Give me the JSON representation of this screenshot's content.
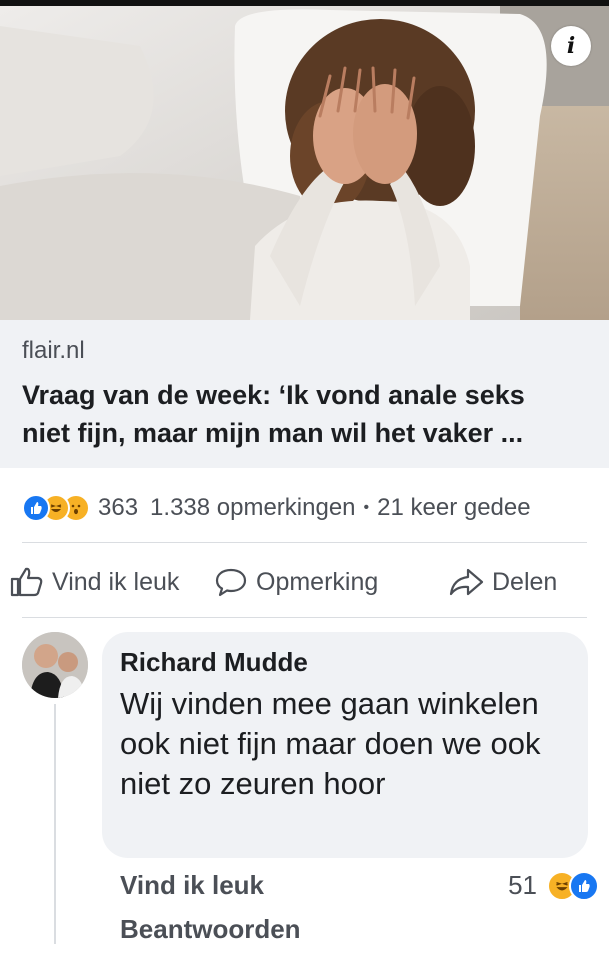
{
  "post": {
    "image_alt": "woman in bed covering her face",
    "info_label": "i",
    "link": {
      "domain": "flair.nl",
      "headline_line1": "Vraag van de week: ‘Ik vond anale seks",
      "headline_line2": "niet fijn, maar mijn man wil het vaker ..."
    },
    "stats": {
      "reaction_count": "363",
      "comments": "1.338 opmerkingen",
      "separator": "•",
      "shares": "21 keer gedee"
    },
    "actions": {
      "like": "Vind ik leuk",
      "comment": "Opmerking",
      "share": "Delen"
    }
  },
  "comment": {
    "author": "Richard Mudde",
    "text": "Wij vinden mee gaan winkelen ook niet fijn maar doen we ook niet zo zeuren hoor",
    "like_label": "Vind ik leuk",
    "reply_label": "Beantwoorden",
    "reaction_count": "51"
  },
  "colors": {
    "facebook_blue": "#1877f2",
    "caption_bg": "#f0f2f5",
    "text_secondary": "#4b4f56",
    "emoji_yellow": "#f7b125"
  }
}
